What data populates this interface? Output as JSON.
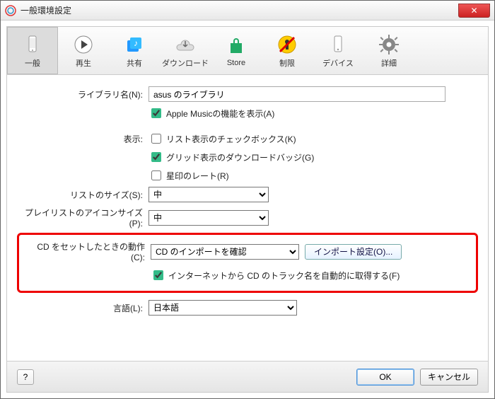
{
  "window": {
    "title": "一般環境設定"
  },
  "toolbar": {
    "tabs": [
      {
        "label": "一般",
        "selected": true
      },
      {
        "label": "再生",
        "selected": false
      },
      {
        "label": "共有",
        "selected": false
      },
      {
        "label": "ダウンロード",
        "selected": false
      },
      {
        "label": "Store",
        "selected": false
      },
      {
        "label": "制限",
        "selected": false
      },
      {
        "label": "デバイス",
        "selected": false
      },
      {
        "label": "詳細",
        "selected": false
      }
    ]
  },
  "library_name": {
    "label": "ライブラリ名(N):",
    "value": "asus のライブラリ"
  },
  "apple_music": {
    "label": "Apple Musicの機能を表示(A)",
    "checked": true
  },
  "display": {
    "label": "表示:",
    "list_checkbox": {
      "label": "リスト表示のチェックボックス(K)",
      "checked": false
    },
    "grid_download": {
      "label": "グリッド表示のダウンロードバッジ(G)",
      "checked": true
    },
    "star_rating": {
      "label": "星印のレート(R)",
      "checked": false
    }
  },
  "list_size": {
    "label": "リストのサイズ(S):",
    "value": "中"
  },
  "pl_icon_size": {
    "label": "プレイリストのアイコンサイズ(P):",
    "value": "中"
  },
  "cd_action": {
    "label": "CD をセットしたときの動作(C):",
    "value": "CD のインポートを確認",
    "import_settings_btn": "インポート設定(O)...",
    "auto_track_names": {
      "label": "インターネットから CD のトラック名を自動的に取得する(F)",
      "checked": true
    }
  },
  "language": {
    "label": "言語(L):",
    "value": "日本語"
  },
  "buttons": {
    "help": "?",
    "ok": "OK",
    "cancel": "キャンセル"
  }
}
